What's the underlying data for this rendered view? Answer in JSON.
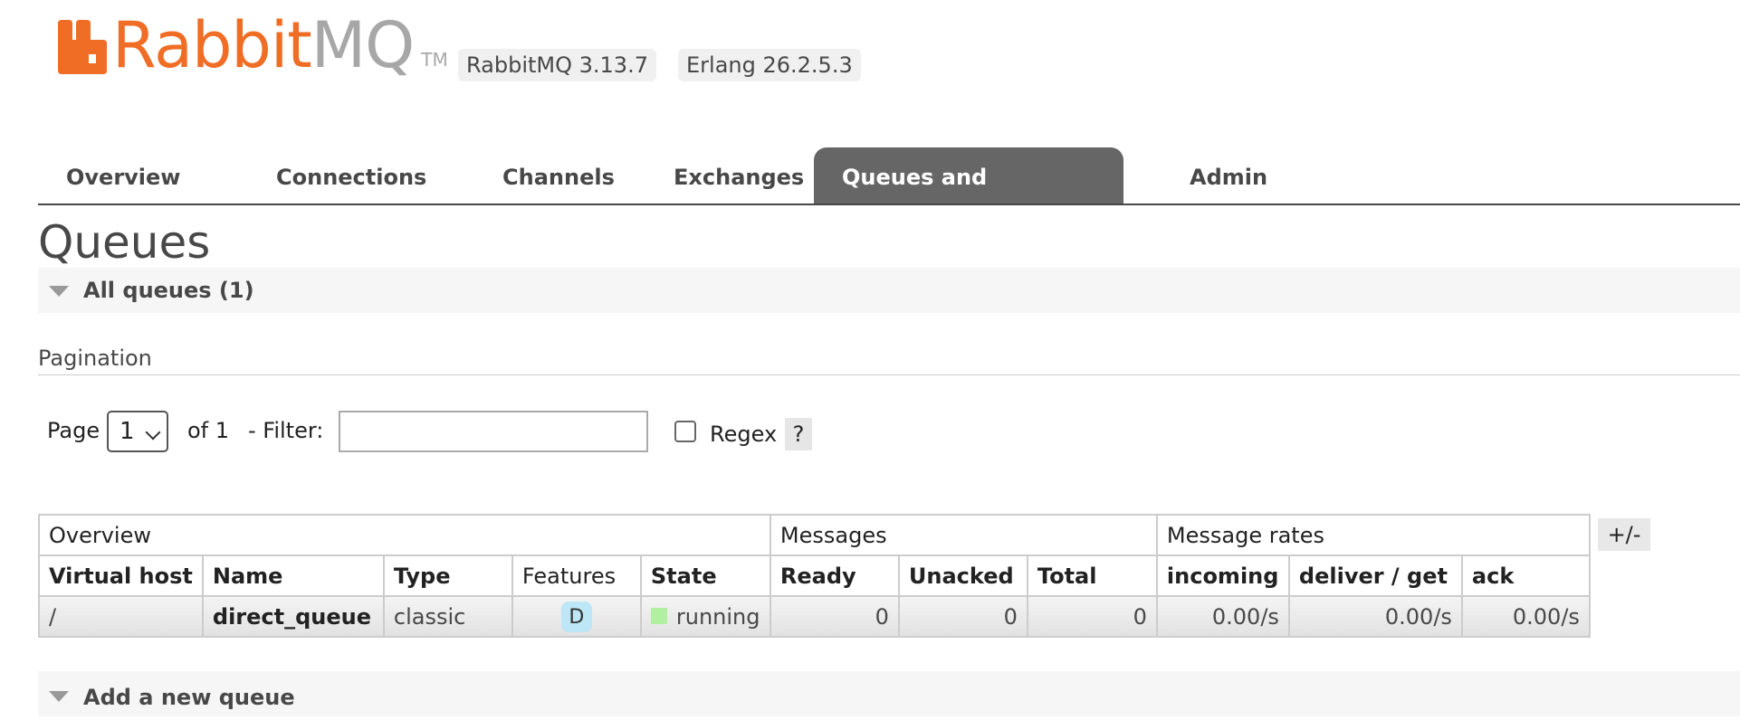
{
  "logo": {
    "rabbit": "Rabbit",
    "mq": "MQ",
    "tm": "TM",
    "brand_color": "#f06d25",
    "mq_color": "#a7a7a7"
  },
  "versions": {
    "rabbitmq": "RabbitMQ 3.13.7",
    "erlang": "Erlang 26.2.5.3"
  },
  "tabs": [
    {
      "label": "Overview",
      "active": false
    },
    {
      "label": "Connections",
      "active": false
    },
    {
      "label": "Channels",
      "active": false
    },
    {
      "label": "Exchanges",
      "active": false
    },
    {
      "label": "Queues and Streams",
      "active": true
    },
    {
      "label": "Admin",
      "active": false
    }
  ],
  "page_title": "Queues",
  "all_queues_section": {
    "label": "All queues (1)",
    "expanded": true
  },
  "pagination": {
    "title": "Pagination",
    "page_label": "Page",
    "page_value": "1",
    "of_label": "of 1",
    "filter_label": "- Filter:",
    "filter_value": "",
    "regex_label": "Regex",
    "regex_checked": false,
    "help_label": "?"
  },
  "table": {
    "groups": [
      "Overview",
      "Messages",
      "Message rates"
    ],
    "columns": [
      "Virtual host",
      "Name",
      "Type",
      "Features",
      "State",
      "Ready",
      "Unacked",
      "Total",
      "incoming",
      "deliver / get",
      "ack"
    ],
    "rows": [
      {
        "vhost": "/",
        "name": "direct_queue",
        "type": "classic",
        "feature": "D",
        "state": "running",
        "ready": "0",
        "unacked": "0",
        "total": "0",
        "incoming": "0.00/s",
        "deliver_get": "0.00/s",
        "ack": "0.00/s"
      }
    ],
    "toggle_columns_label": "+/-"
  },
  "add_queue_section": {
    "label": "Add a new queue",
    "expanded": false
  },
  "colors": {
    "active_tab_bg": "#666666",
    "running_state": "#b0f0a0",
    "durable_badge": "#bde6f7"
  }
}
